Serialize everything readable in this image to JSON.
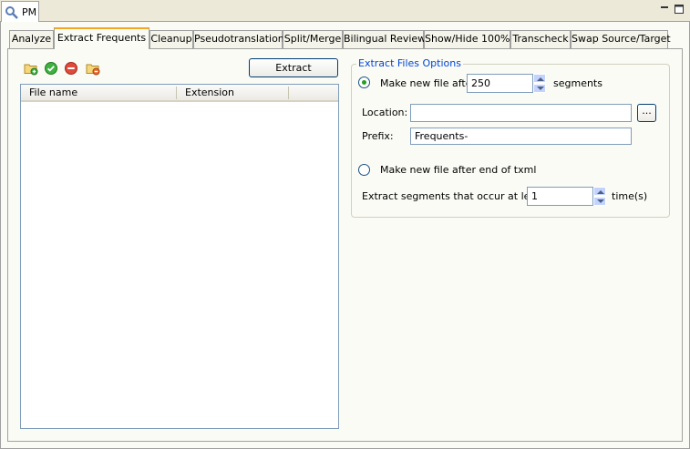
{
  "view": {
    "title": "PM"
  },
  "tabs": [
    {
      "label": "Analyze"
    },
    {
      "label": "Extract Frequents"
    },
    {
      "label": "Cleanup"
    },
    {
      "label": "Pseudotranslation"
    },
    {
      "label": "Split/Merge"
    },
    {
      "label": "Bilingual Review"
    },
    {
      "label": "Show/Hide 100%"
    },
    {
      "label": "Transcheck"
    },
    {
      "label": "Swap Source/Target"
    }
  ],
  "active_tab": "Extract Frequents",
  "toolbar": {
    "icons": [
      "add-folder-icon",
      "check-icon",
      "remove-icon",
      "delete-folder-icon"
    ],
    "extract_label": "Extract"
  },
  "file_table": {
    "columns": [
      "File name",
      "Extension"
    ],
    "rows": []
  },
  "options": {
    "group_title": "Extract Files Options",
    "radio1_label": "Make new file after",
    "radio1_selected": true,
    "segments_value": "250",
    "segments_unit": "segments",
    "location_label": "Location:",
    "location_value": "",
    "browse_label": "...",
    "prefix_label": "Prefix:",
    "prefix_value": "Frequents-",
    "radio2_label": "Make new file after end of txml",
    "radio2_selected": false,
    "occur_label": "Extract segments that occur at least",
    "occur_value": "1",
    "occur_unit": "time(s)"
  },
  "colors": {
    "accent": "#f5a623",
    "group_title": "#0046d5",
    "radio_selected": "#21a121"
  }
}
